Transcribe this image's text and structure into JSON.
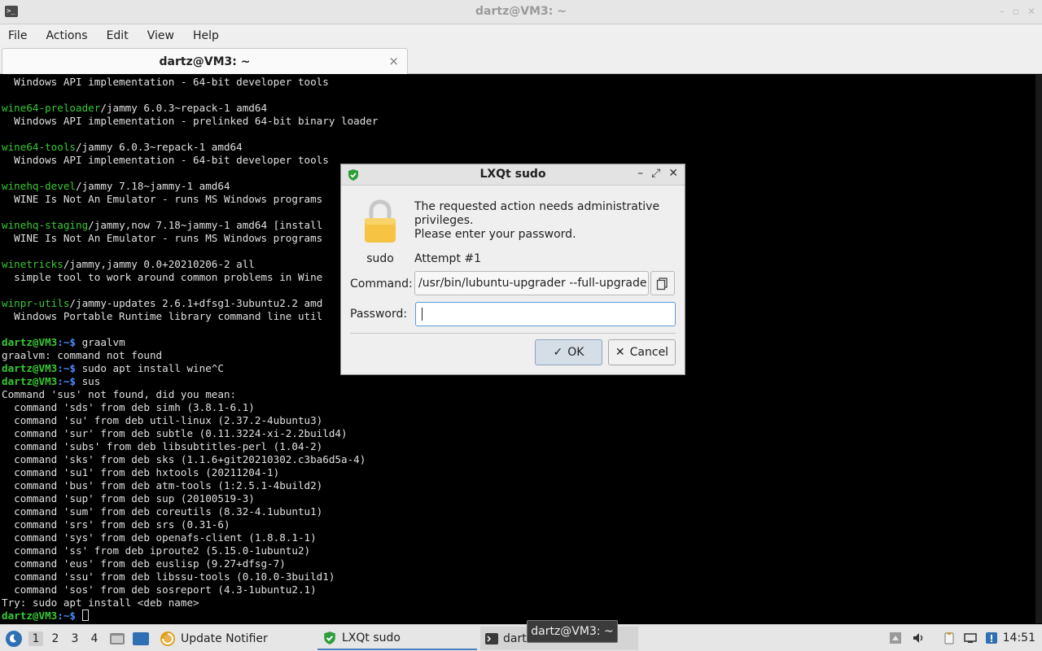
{
  "window": {
    "title": "dartz@VM3: ~",
    "controls": [
      "minimize",
      "maximize",
      "close"
    ]
  },
  "menu": {
    "items": [
      "File",
      "Actions",
      "Edit",
      "View",
      "Help"
    ]
  },
  "tab": {
    "label": "dartz@VM3: ~",
    "close": "×"
  },
  "terminal": {
    "lines": [
      {
        "pre": "",
        "pkg": "",
        "rest": "  Windows API implementation - 64-bit developer tools"
      },
      {
        "pre": "",
        "pkg": "",
        "rest": ""
      },
      {
        "pre": "",
        "pkg": "wine64-preloader",
        "rest": "/jammy 6.0.3~repack-1 amd64"
      },
      {
        "pre": "",
        "pkg": "",
        "rest": "  Windows API implementation - prelinked 64-bit binary loader"
      },
      {
        "pre": "",
        "pkg": "",
        "rest": ""
      },
      {
        "pre": "",
        "pkg": "wine64-tools",
        "rest": "/jammy 6.0.3~repack-1 amd64"
      },
      {
        "pre": "",
        "pkg": "",
        "rest": "  Windows API implementation - 64-bit developer tools"
      },
      {
        "pre": "",
        "pkg": "",
        "rest": ""
      },
      {
        "pre": "",
        "pkg": "winehq-devel",
        "rest": "/jammy 7.18~jammy-1 amd64"
      },
      {
        "pre": "",
        "pkg": "",
        "rest": "  WINE Is Not An Emulator - runs MS Windows programs"
      },
      {
        "pre": "",
        "pkg": "",
        "rest": ""
      },
      {
        "pre": "",
        "pkg": "winehq-staging",
        "rest": "/jammy,now 7.18~jammy-1 amd64 [install"
      },
      {
        "pre": "",
        "pkg": "",
        "rest": "  WINE Is Not An Emulator - runs MS Windows programs"
      },
      {
        "pre": "",
        "pkg": "",
        "rest": ""
      },
      {
        "pre": "",
        "pkg": "winetricks",
        "rest": "/jammy,jammy 0.0+20210206-2 all"
      },
      {
        "pre": "",
        "pkg": "",
        "rest": "  simple tool to work around common problems in Wine"
      },
      {
        "pre": "",
        "pkg": "",
        "rest": ""
      },
      {
        "pre": "",
        "pkg": "winpr-utils",
        "rest": "/jammy-updates 2.6.1+dfsg1-3ubuntu2.2 amd"
      },
      {
        "pre": "",
        "pkg": "",
        "rest": "  Windows Portable Runtime library command line util"
      },
      {
        "pre": "",
        "pkg": "",
        "rest": ""
      },
      {
        "prompt": true,
        "cmd": " graalvm"
      },
      {
        "pre": "",
        "pkg": "",
        "rest": "graalvm: command not found"
      },
      {
        "prompt": true,
        "cmd": " sudo apt install wine^C"
      },
      {
        "prompt": true,
        "cmd": " sus"
      },
      {
        "pre": "",
        "pkg": "",
        "rest": "Command 'sus' not found, did you mean:"
      },
      {
        "pre": "",
        "pkg": "",
        "rest": "  command 'sds' from deb simh (3.8.1-6.1)"
      },
      {
        "pre": "",
        "pkg": "",
        "rest": "  command 'su' from deb util-linux (2.37.2-4ubuntu3)"
      },
      {
        "pre": "",
        "pkg": "",
        "rest": "  command 'sur' from deb subtle (0.11.3224-xi-2.2build4)"
      },
      {
        "pre": "",
        "pkg": "",
        "rest": "  command 'subs' from deb libsubtitles-perl (1.04-2)"
      },
      {
        "pre": "",
        "pkg": "",
        "rest": "  command 'sks' from deb sks (1.1.6+git20210302.c3ba6d5a-4)"
      },
      {
        "pre": "",
        "pkg": "",
        "rest": "  command 'su1' from deb hxtools (20211204-1)"
      },
      {
        "pre": "",
        "pkg": "",
        "rest": "  command 'bus' from deb atm-tools (1:2.5.1-4build2)"
      },
      {
        "pre": "",
        "pkg": "",
        "rest": "  command 'sup' from deb sup (20100519-3)"
      },
      {
        "pre": "",
        "pkg": "",
        "rest": "  command 'sum' from deb coreutils (8.32-4.1ubuntu1)"
      },
      {
        "pre": "",
        "pkg": "",
        "rest": "  command 'srs' from deb srs (0.31-6)"
      },
      {
        "pre": "",
        "pkg": "",
        "rest": "  command 'sys' from deb openafs-client (1.8.8.1-1)"
      },
      {
        "pre": "",
        "pkg": "",
        "rest": "  command 'ss' from deb iproute2 (5.15.0-1ubuntu2)"
      },
      {
        "pre": "",
        "pkg": "",
        "rest": "  command 'eus' from deb euslisp (9.27+dfsg-7)"
      },
      {
        "pre": "",
        "pkg": "",
        "rest": "  command 'ssu' from deb libssu-tools (0.10.0-3build1)"
      },
      {
        "pre": "",
        "pkg": "",
        "rest": "  command 'sos' from deb sosreport (4.3-1ubuntu2.1)"
      },
      {
        "pre": "",
        "pkg": "",
        "rest": "Try: sudo apt install <deb name>"
      },
      {
        "prompt": true,
        "cmd": " ",
        "cursor": true
      }
    ],
    "prompt_user": "dartz@VM3",
    "prompt_path": ":~$"
  },
  "dialog": {
    "title": "LXQt sudo",
    "controls": [
      "–",
      "⤢",
      "✕"
    ],
    "message": "The requested action needs administrative privileges.\nPlease enter your password.",
    "message_line1": "The requested action needs administrative",
    "message_line2": "privileges.",
    "message_line3": "Please enter your password.",
    "icon_label": "sudo",
    "attempt": "Attempt #1",
    "command_label": "Command:",
    "command_value": "/usr/bin/lubuntu-upgrader --full-upgrade",
    "password_label": "Password:",
    "password_value": "",
    "ok_label": "OK",
    "cancel_label": "Cancel"
  },
  "taskbar": {
    "workspaces": [
      "1",
      "2",
      "3",
      "4"
    ],
    "active_workspace": "1",
    "tasks": [
      {
        "label": "Update Notifier",
        "icon": "update-notifier-icon"
      },
      {
        "label": "LXQt sudo",
        "icon": "shield-icon"
      },
      {
        "label": "dart",
        "icon": "terminal-icon"
      }
    ],
    "tooltip": "dartz@VM3: ~",
    "clock": "14:51"
  },
  "colors": {
    "prompt_green": "#38c934",
    "path_blue": "#4a8dff",
    "terminal_bg": "#000000"
  }
}
